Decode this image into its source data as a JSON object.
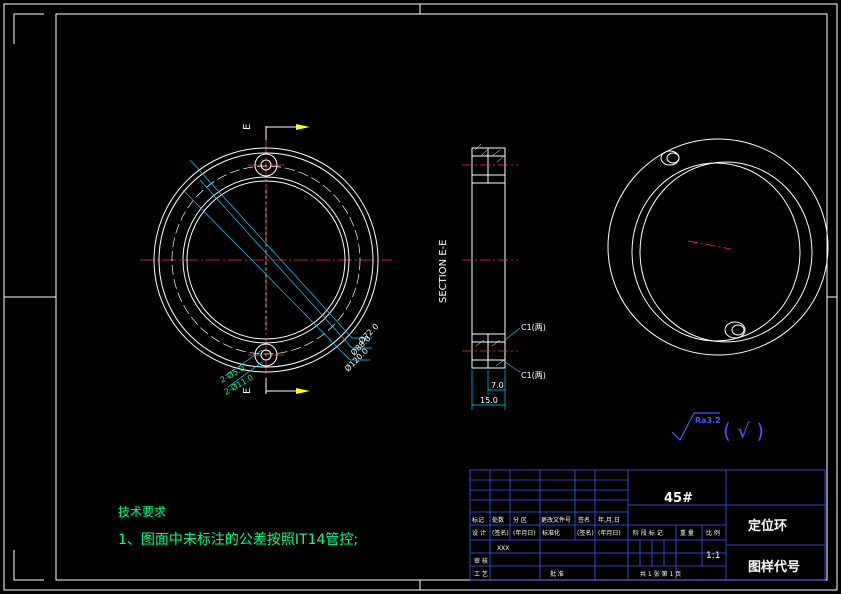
{
  "section_marker": "E",
  "section_label": "SECTION  E-E",
  "dimensions": {
    "d_outer": "Ø120.0",
    "d_mid": "Ø88.0",
    "d_inner": "Ø72.0",
    "holes_a": "2-Ø5.0",
    "holes_b": "2-Ø11.0",
    "thickness": "15.0",
    "step": "7.0",
    "chamfer_1": "C1(两)",
    "chamfer_2": "C1(两)"
  },
  "surface_finish": {
    "value": "Ra3.2",
    "note": "( √ )"
  },
  "technical_requirements": {
    "heading": "技术要求",
    "item_1": "1、图面中未标注的公差按照IT14管控;"
  },
  "title_block": {
    "material": "45#",
    "part_name": "定位环",
    "drawing_code": "图样代号",
    "scale": "1:1",
    "sheet_text": "共 1 张    第 1 页",
    "designer": "XXX",
    "row_labels": [
      "标记",
      "处数",
      "分 区",
      "更改文件号",
      "签名",
      "年,月,日"
    ],
    "row_values": [
      "设 计",
      "(签名)",
      "(年月日)",
      "标准化",
      "(签名)",
      "(年月日)"
    ],
    "stage_labels": [
      "阶 段 标 记",
      "重 量",
      "比 例"
    ],
    "review": "审 核",
    "process": "工 艺",
    "approve": "批 准"
  }
}
